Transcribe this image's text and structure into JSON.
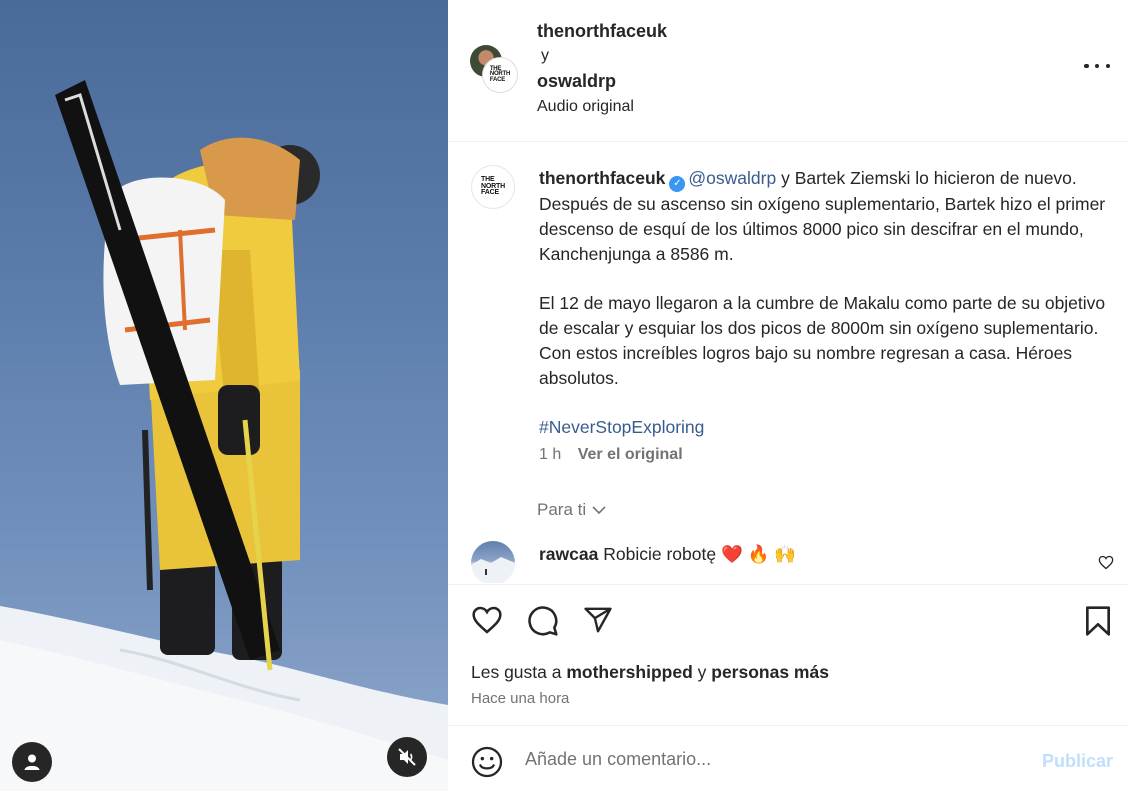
{
  "post": {
    "author": "thenorthfaceuk",
    "connector": "y",
    "coauthor": "oswaldrp",
    "audio": "Audio original",
    "more_icon": "more-options-icon",
    "logo_text": [
      "THE",
      "NORTH",
      "FACE"
    ]
  },
  "caption": {
    "username": "thenorthfaceuk",
    "mention": "@oswaldrp",
    "paragraph1_rest": " y Bartek Ziemski lo hicieron de nuevo. Después de su ascenso sin oxígeno suplementario, Bartek hizo el primer descenso de esquí de los últimos 8000 pico sin descifrar en el mundo, Kanchenjunga a 8586 m.",
    "paragraph2": "El 12 de mayo llegaron a la cumbre de Makalu como parte de su objetivo de escalar y esquiar los dos picos de 8000m sin oxígeno suplementario. Con estos increíbles logros bajo su nombre regresan a casa. Héroes absolutos.",
    "hashtag": "#NeverStopExploring",
    "time": "1 h",
    "see_original": "Ver el original"
  },
  "for_you": {
    "label": "Para ti",
    "icon": "chevron-down-icon"
  },
  "comments": [
    {
      "username": "rawcaa",
      "text": "Robicie robotę",
      "emojis": "❤️ 🔥 🙌"
    }
  ],
  "actions": {
    "likes_prefix": "Les gusta a ",
    "liked_by": "mothershipped",
    "likes_connector": " y ",
    "likes_suffix": "personas más",
    "time_ago": "Hace una hora"
  },
  "comment_box": {
    "placeholder": "Añade un comentario...",
    "publish_label": "Publicar"
  },
  "colors": {
    "link": "#385c8e",
    "verified": "#3897f0",
    "publish_disabled": "#c0dffd",
    "muted_text": "#737373"
  }
}
